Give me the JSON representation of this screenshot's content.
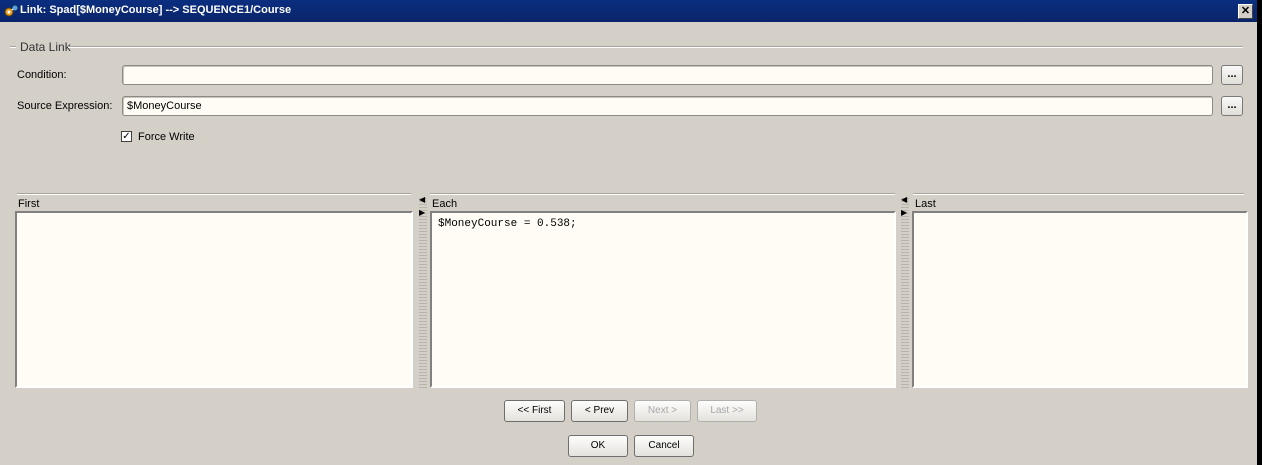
{
  "window": {
    "title": "Link: Spad[$MoneyCourse] --> SEQUENCE1/Course",
    "close_glyph": "✕"
  },
  "group": {
    "label": "Data Link"
  },
  "condition": {
    "label": "Condition:",
    "value": "",
    "browse_label": "..."
  },
  "source_expression": {
    "label": "Source Expression:",
    "value": "$MoneyCourse",
    "browse_label": "..."
  },
  "force_write": {
    "label": "Force Write",
    "checked": true,
    "check_glyph": "✓"
  },
  "panels": {
    "first": {
      "label": "First",
      "content": ""
    },
    "each": {
      "label": "Each",
      "content": "$MoneyCourse = 0.538;"
    },
    "last": {
      "label": "Last",
      "content": ""
    }
  },
  "splitter_arrows": {
    "left": "◀",
    "right": "▶"
  },
  "navigation": {
    "first": "<< First",
    "prev": "< Prev",
    "next": "Next >",
    "last": "Last >>"
  },
  "dialog_buttons": {
    "ok": "OK",
    "cancel": "Cancel"
  }
}
